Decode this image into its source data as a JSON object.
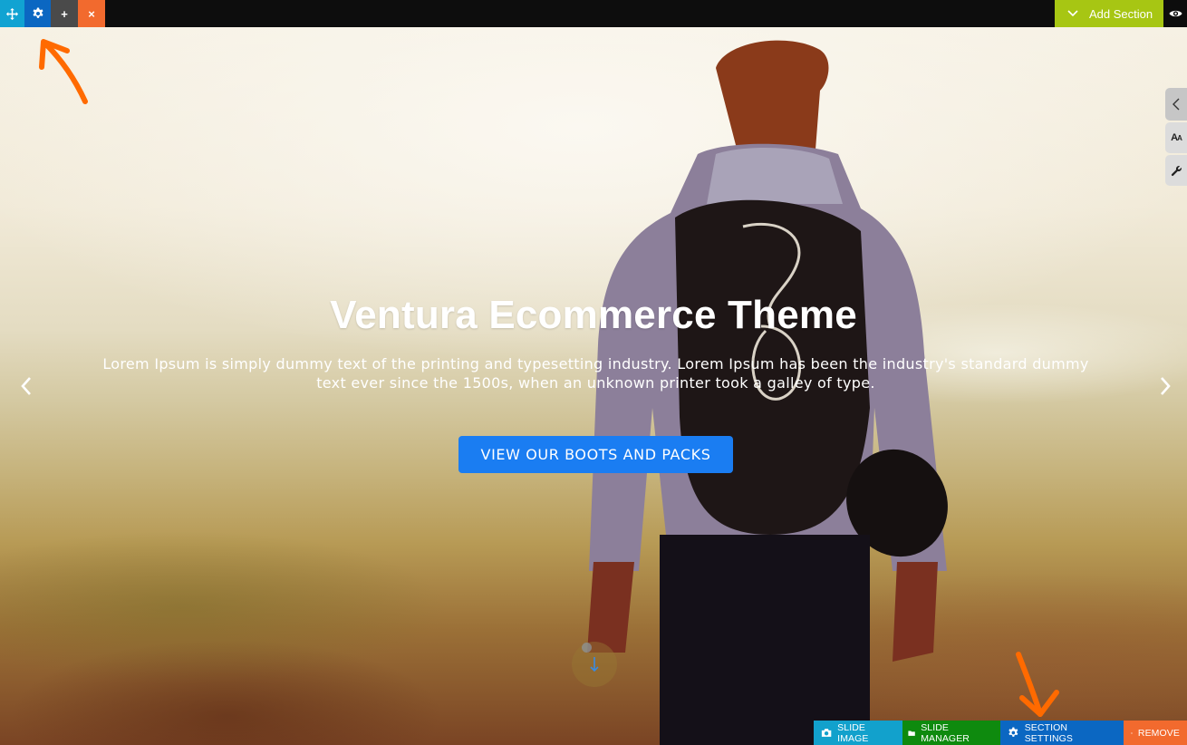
{
  "top_toolbar": {
    "buttons": [
      {
        "name": "move",
        "icon": "move-icon",
        "color": "#11a3d2"
      },
      {
        "name": "settings",
        "icon": "gear-icon",
        "color": "#0b67c2"
      },
      {
        "name": "add",
        "icon": "plus-icon",
        "label": "+",
        "color": "#4a4a4a"
      },
      {
        "name": "close",
        "icon": "close-icon",
        "label": "×",
        "color": "#f26a2e"
      }
    ],
    "add_section_label": "Add Section",
    "add_section_color": "#a7c613",
    "preview_icon": "eye-icon"
  },
  "side_tabs": [
    {
      "icon": "chevron-left-icon"
    },
    {
      "icon": "typography-icon",
      "label_big": "A",
      "label_small": "A"
    },
    {
      "icon": "wrench-icon"
    }
  ],
  "hero": {
    "title": "Ventura Ecommerce Theme",
    "subtitle": "Lorem Ipsum is simply dummy text of the printing and typesetting industry. Lorem Ipsum has been the industry's standard dummy text ever since the 1500s, when an unknown printer took a galley of type.",
    "cta_label": "VIEW OUR BOOTS AND PACKS",
    "cta_color": "#1a7df2",
    "prev_icon": "chevron-left-icon",
    "next_icon": "chevron-right-icon",
    "scroll_icon": "arrow-down-icon"
  },
  "bottom_toolbar": {
    "buttons": [
      {
        "label": "SLIDE IMAGE",
        "icon": "camera-icon",
        "color": "#12a1cc"
      },
      {
        "label": "SLIDE MANAGER",
        "icon": "folder-icon",
        "color": "#0e8a0e"
      },
      {
        "label": "SECTION SETTINGS",
        "icon": "gear-icon",
        "color": "#0b67c2"
      },
      {
        "label": "REMOVE",
        "icon": "close-icon",
        "color": "#f26a2e"
      }
    ]
  },
  "annotations": {
    "arrow_color": "#ff6a00"
  }
}
